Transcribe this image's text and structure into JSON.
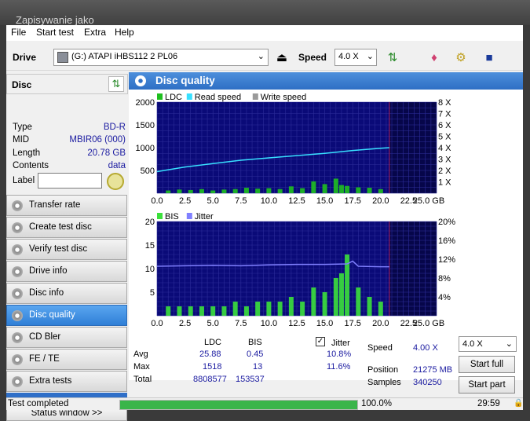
{
  "window": {
    "title": "Zapisywanie jako"
  },
  "menu": [
    "File",
    "Start test",
    "Extra",
    "Help"
  ],
  "toolbar": {
    "drive_label": "Drive",
    "drive_value": "(G:)   ATAPI iHBS112   2 PL06",
    "speed_label": "Speed",
    "speed_value": "4.0 X"
  },
  "disc": {
    "header": "Disc",
    "type_k": "Type",
    "type_v": "BD-R",
    "mid_k": "MID",
    "mid_v": "MBIR06 (000)",
    "length_k": "Length",
    "length_v": "20.78 GB",
    "contents_k": "Contents",
    "contents_v": "data",
    "label_k": "Label"
  },
  "nav": [
    {
      "label": "Transfer rate"
    },
    {
      "label": "Create test disc"
    },
    {
      "label": "Verify test disc"
    },
    {
      "label": "Drive info"
    },
    {
      "label": "Disc info"
    },
    {
      "label": "Disc quality"
    },
    {
      "label": "CD Bler"
    },
    {
      "label": "FE / TE"
    },
    {
      "label": "Extra tests"
    }
  ],
  "status_window": "Status window >>",
  "panel": {
    "title": "Disc quality"
  },
  "chart_data": [
    {
      "type": "line",
      "legend": [
        "LDC",
        "Read speed",
        "Write speed"
      ],
      "x_ticks": [
        "0.0",
        "2.5",
        "5.0",
        "7.5",
        "10.0",
        "12.5",
        "15.0",
        "17.5",
        "20.0",
        "22.5",
        "25.0 GB"
      ],
      "y_ticks_left": [
        "2000",
        "1500",
        "1000",
        "500"
      ],
      "y_ticks_right": [
        "8 X",
        "7 X",
        "6 X",
        "5 X",
        "4 X",
        "3 X",
        "2 X",
        "1 X"
      ],
      "xlim": [
        0,
        25
      ],
      "ylim": [
        0,
        2000
      ],
      "y2lim": [
        0,
        8
      ],
      "data_end_gb": 20.78,
      "read_speed": {
        "x": [
          0,
          2.5,
          5,
          7.5,
          10,
          12.5,
          15,
          17.5,
          20,
          20.78
        ],
        "y": [
          1.9,
          2.3,
          2.6,
          2.9,
          3.1,
          3.3,
          3.5,
          3.75,
          3.95,
          4.0
        ]
      },
      "ldc": {
        "x": [
          1,
          2,
          3,
          4,
          5,
          6,
          7,
          8,
          9,
          10,
          11,
          12,
          13,
          14,
          15,
          16,
          16.5,
          17,
          18,
          19,
          20
        ],
        "y": [
          60,
          80,
          70,
          90,
          60,
          80,
          90,
          120,
          100,
          110,
          90,
          150,
          110,
          260,
          200,
          320,
          180,
          160,
          130,
          120,
          90
        ]
      }
    },
    {
      "type": "line",
      "legend": [
        "BIS",
        "Jitter"
      ],
      "x_ticks": [
        "0.0",
        "2.5",
        "5.0",
        "7.5",
        "10.0",
        "12.5",
        "15.0",
        "17.5",
        "20.0",
        "22.5",
        "25.0 GB"
      ],
      "y_ticks_left": [
        "20",
        "15",
        "10",
        "5"
      ],
      "y_ticks_right": [
        "20%",
        "16%",
        "12%",
        "8%",
        "4%"
      ],
      "xlim": [
        0,
        25
      ],
      "ylim": [
        0,
        20
      ],
      "y2lim": [
        0,
        20
      ],
      "data_end_gb": 20.78,
      "jitter": {
        "x": [
          0,
          2.5,
          5,
          7.5,
          10,
          12.5,
          15,
          17,
          17.5,
          18,
          20,
          20.78
        ],
        "y": [
          10.5,
          10.6,
          10.7,
          10.6,
          10.8,
          10.9,
          10.9,
          11.0,
          11.6,
          10.5,
          10.4,
          10.4
        ]
      },
      "bis": {
        "x": [
          1,
          2,
          3,
          4,
          5,
          6,
          7,
          8,
          9,
          10,
          11,
          12,
          13,
          14,
          15,
          16,
          16.5,
          17,
          18,
          19,
          20
        ],
        "y": [
          2,
          2,
          2,
          2,
          2,
          2,
          3,
          2,
          3,
          3,
          3,
          4,
          3,
          6,
          5,
          8,
          9,
          13,
          6,
          4,
          3
        ]
      }
    }
  ],
  "stats": {
    "col_ldc": "LDC",
    "col_bis": "BIS",
    "jitter_label": "Jitter",
    "avg_label": "Avg",
    "avg_ldc": "25.88",
    "avg_bis": "0.45",
    "avg_jitter": "10.8%",
    "max_label": "Max",
    "max_ldc": "1518",
    "max_bis": "13",
    "max_jitter": "11.6%",
    "total_label": "Total",
    "total_ldc": "8808577",
    "total_bis": "153537",
    "speed_label": "Speed",
    "speed_value": "4.00 X",
    "position_label": "Position",
    "position_value": "21275 MB",
    "samples_label": "Samples",
    "samples_value": "340250",
    "speed_select": "4.0 X",
    "start_full": "Start full",
    "start_part": "Start part"
  },
  "status": {
    "text": "Test completed",
    "percent_label": "100.0%",
    "progress": 1.0,
    "time": "29:59"
  },
  "colors": {
    "plot_bg": "#0a0a78",
    "ldc": "#1fbf1f",
    "read_speed": "#38e0ff",
    "jitter": "#8080ff",
    "bis": "#3be03b"
  }
}
